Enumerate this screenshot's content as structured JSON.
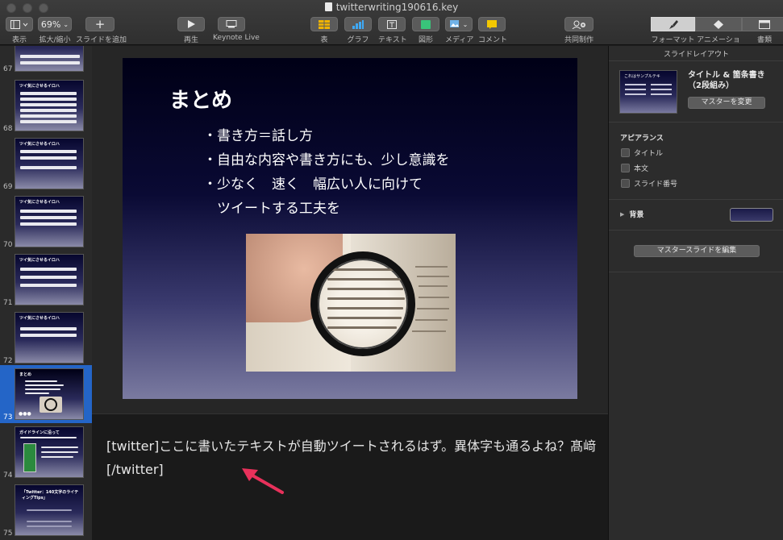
{
  "window": {
    "title": "twitterwriting190616.key"
  },
  "toolbar": {
    "view_label": "表示",
    "zoom_value": "69%",
    "zoom_label": "拡大/縮小",
    "add_slide_label": "スライドを追加",
    "play_label": "再生",
    "keynote_live_label": "Keynote Live",
    "table_label": "表",
    "chart_label": "グラフ",
    "text_label": "テキスト",
    "shape_label": "図形",
    "media_label": "メディア",
    "comment_label": "コメント",
    "collaborate_label": "共同制作",
    "format_label": "フォーマット",
    "animate_label": "アニメーション",
    "document_label": "書類"
  },
  "navigator": {
    "slides": [
      {
        "number": "67",
        "title": ""
      },
      {
        "number": "68",
        "title": "ツイ気にさせるイロハ"
      },
      {
        "number": "69",
        "title": "ツイ気にさせるイロハ"
      },
      {
        "number": "70",
        "title": "ツイ気にさせるイロハ"
      },
      {
        "number": "71",
        "title": "ツイ気にさせるイロハ"
      },
      {
        "number": "72",
        "title": "ツイ気にさせるイロハ"
      },
      {
        "number": "73",
        "title": "まとめ"
      },
      {
        "number": "74",
        "title": "ガイドラインに沿って"
      },
      {
        "number": "75",
        "title": "「Twitter：140文字のライティングTips」"
      }
    ],
    "selected": "73"
  },
  "slide": {
    "title": "まとめ",
    "bullets": [
      "・書き方＝話し方",
      "・自由な内容や書き方にも、少し意識を",
      "・少なく　速く　幅広い人に向けて",
      "　ツイートする工夫を"
    ],
    "image_alt": "magnifying-glass-over-book-photo"
  },
  "notes": {
    "text": "[twitter]ここに書いたテキストが自動ツイートされるはず。異体字も通るよね？髙﨑[/twitter]"
  },
  "inspector": {
    "header": "スライドレイアウト",
    "master_thumb_title": "これはサンプルテキ",
    "master_name": "タイトル & 箇条書き（2段組み）",
    "change_master_button": "マスターを変更",
    "appearance_title": "アピアランス",
    "checkbox_title": "タイトル",
    "checkbox_body": "本文",
    "checkbox_slide_number": "スライド番号",
    "background_label": "背景",
    "edit_master_button": "マスタースライドを編集"
  },
  "colors": {
    "selection": "#2465c7",
    "annotation_arrow": "#e8315b",
    "slide_bg_top": "#000016",
    "slide_bg_bottom": "#7a7aa0"
  }
}
